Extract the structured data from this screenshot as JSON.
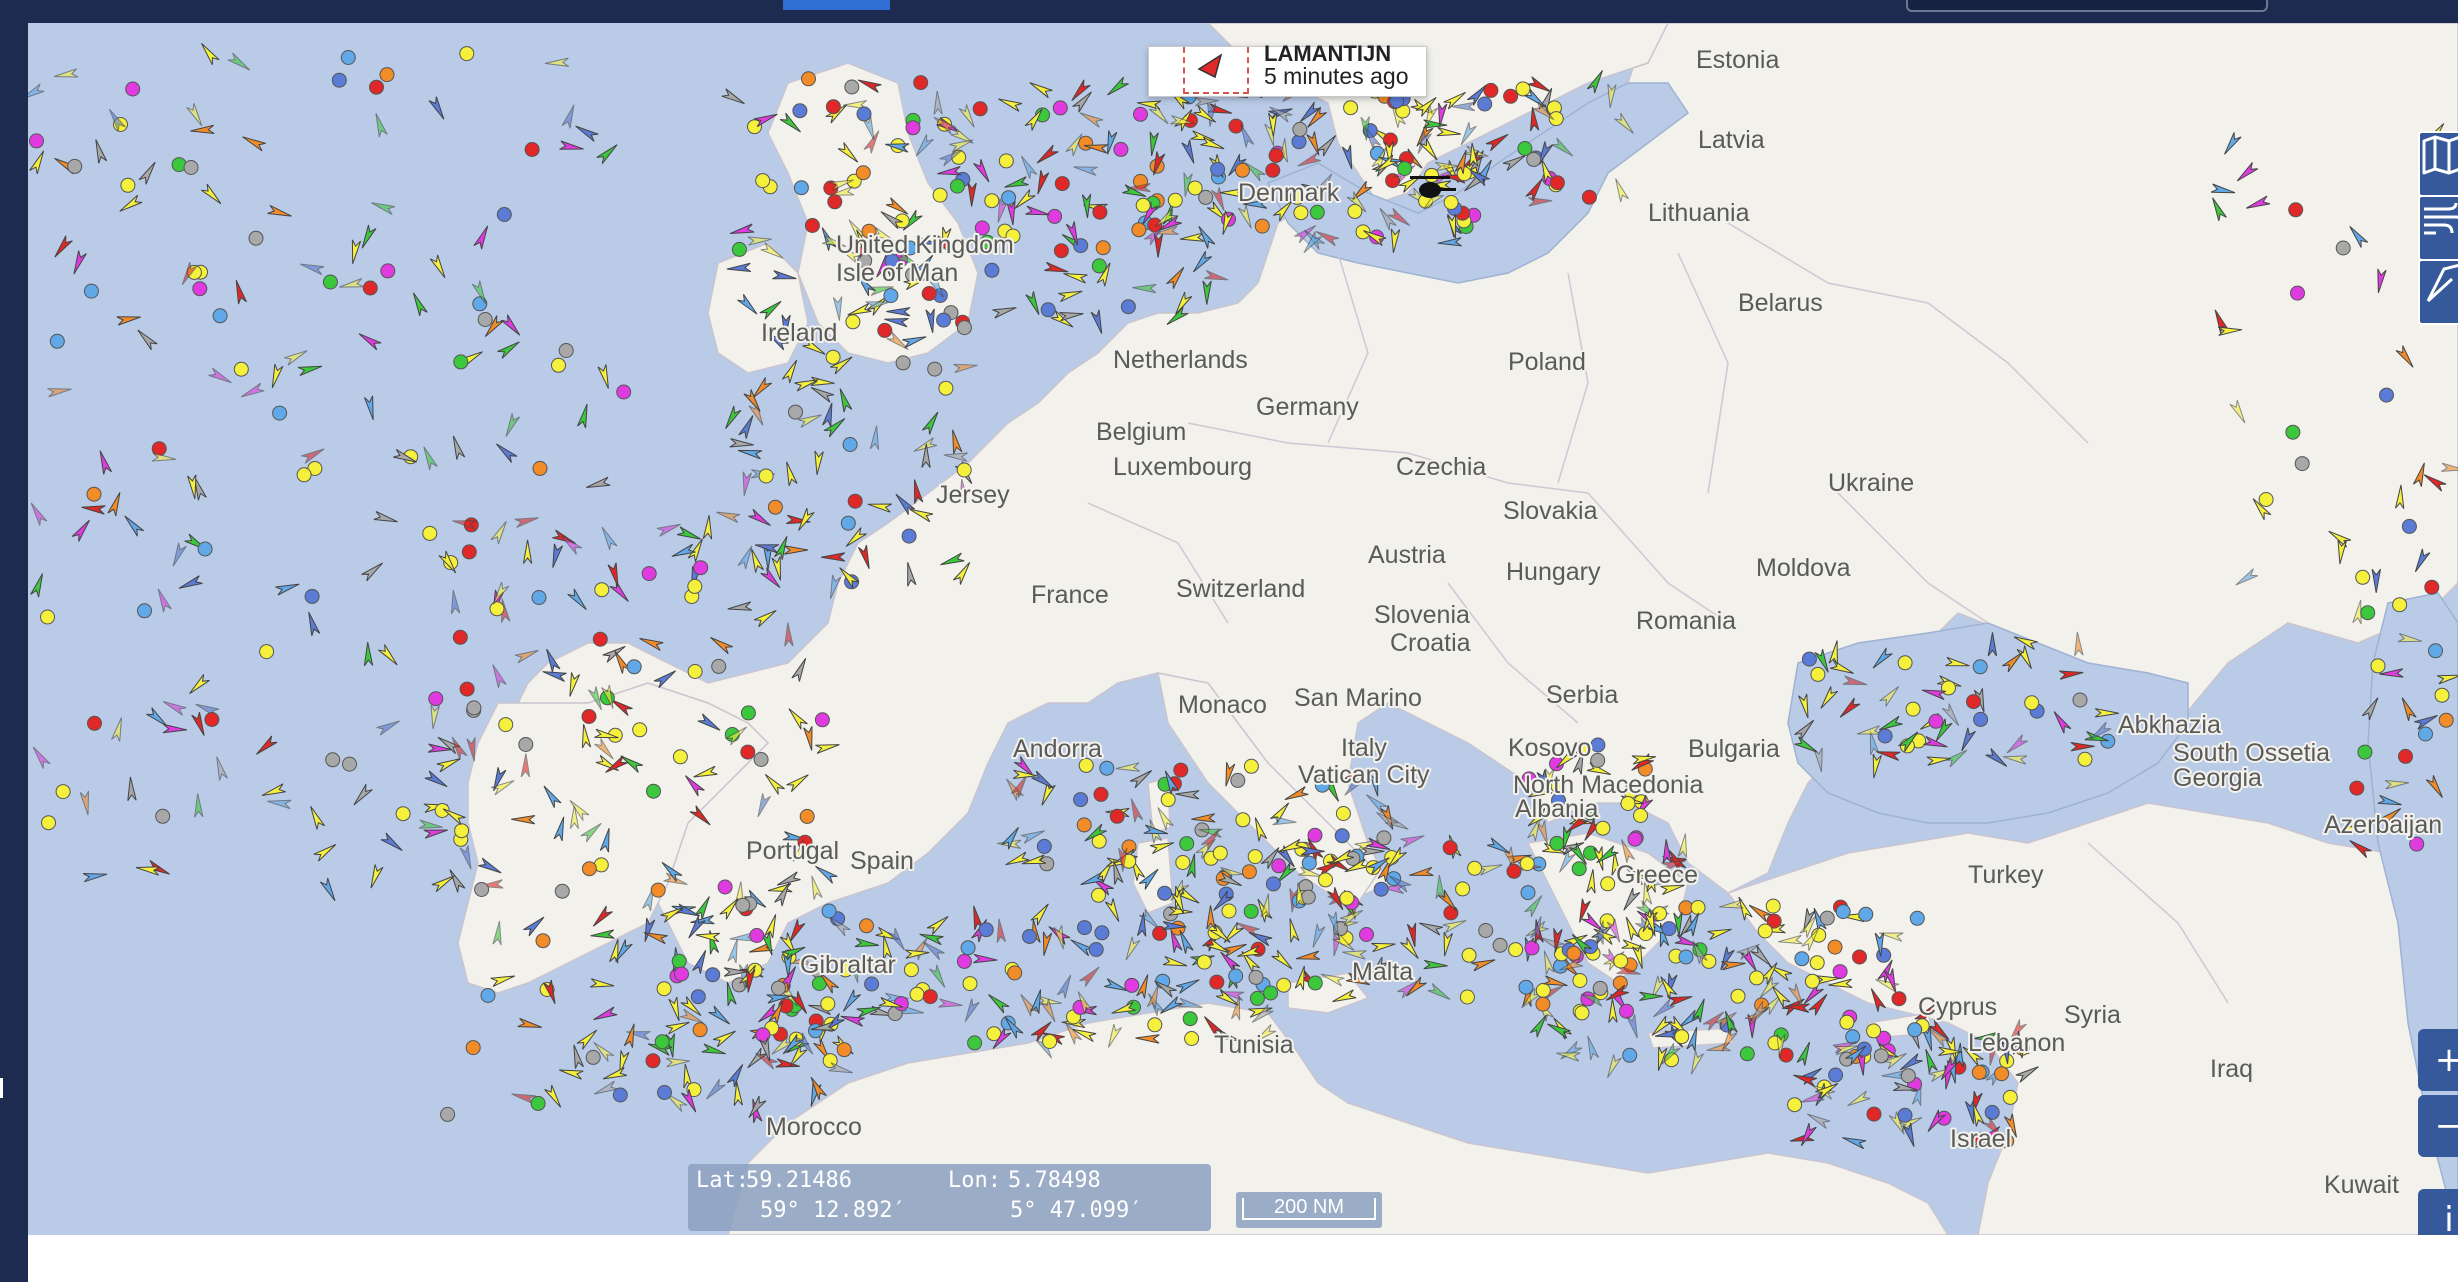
{
  "popup": {
    "vessel_name": "LAMANTIJN",
    "time_ago": "5 minutes ago"
  },
  "map": {
    "labels": [
      {
        "text": "Estonia"
      },
      {
        "text": "Latvia"
      },
      {
        "text": "Denmark"
      },
      {
        "text": "Lithuania"
      },
      {
        "text": "United Kingdom"
      },
      {
        "text": "Isle of Man"
      },
      {
        "text": "Belarus"
      },
      {
        "text": "Ireland"
      },
      {
        "text": "Poland"
      },
      {
        "text": "Netherlands"
      },
      {
        "text": "Germany"
      },
      {
        "text": "Belgium"
      },
      {
        "text": "Luxembourg"
      },
      {
        "text": "Czechia"
      },
      {
        "text": "Jersey"
      },
      {
        "text": "Ukraine"
      },
      {
        "text": "Slovakia"
      },
      {
        "text": "Austria"
      },
      {
        "text": "Hungary"
      },
      {
        "text": "Moldova"
      },
      {
        "text": "France"
      },
      {
        "text": "Switzerland"
      },
      {
        "text": "Slovenia"
      },
      {
        "text": "Croatia"
      },
      {
        "text": "Romania"
      },
      {
        "text": "Serbia"
      },
      {
        "text": "Monaco"
      },
      {
        "text": "San Marino"
      },
      {
        "text": "Andorra"
      },
      {
        "text": "Italy"
      },
      {
        "text": "Vatican City"
      },
      {
        "text": "Kosovo"
      },
      {
        "text": "Bulgaria"
      },
      {
        "text": "Abkhazia"
      },
      {
        "text": "South Ossetia"
      },
      {
        "text": "Georgia"
      },
      {
        "text": "North Macedonia"
      },
      {
        "text": "Albania"
      },
      {
        "text": "Azerbaijan"
      },
      {
        "text": "Portugal"
      },
      {
        "text": "Spain"
      },
      {
        "text": "Greece"
      },
      {
        "text": "Turkey"
      },
      {
        "text": "Gibraltar"
      },
      {
        "text": "Malta"
      },
      {
        "text": "Syria"
      },
      {
        "text": "Cyprus"
      },
      {
        "text": "Lebanon"
      },
      {
        "text": "Tunisia"
      },
      {
        "text": "Iraq"
      },
      {
        "text": "Morocco"
      },
      {
        "text": "Israel"
      },
      {
        "text": "Kuwait"
      }
    ]
  },
  "coords": {
    "lat_label": "Lat:",
    "lat_decimal": "59.21486",
    "lon_label": "Lon:",
    "lon_decimal": "5.78498",
    "lat_dms": "59° 12.892′",
    "lon_dms": "5° 47.099′"
  },
  "scale": {
    "label": "200 NM"
  },
  "controls": {
    "zoom_in": "+",
    "zoom_out": "−",
    "info": "i",
    "layers_icon": "map-layers-icon",
    "weather_icon": "wind-icon",
    "measure_icon": "measure-icon"
  },
  "colors": {
    "sea": "#b9cbe7",
    "land": "#f2f1ec",
    "ship_yellow": "#f5f03c",
    "ship_orange": "#f28c28",
    "ship_magenta": "#e03be0",
    "ship_blue": "#5a7bd6",
    "ship_green": "#3cc83c",
    "ship_red": "#e02828",
    "ship_gray": "#a8a8a8",
    "ship_cyan": "#60a8e8",
    "ui_blue": "#35599a",
    "topbar": "#1c2b4f"
  }
}
